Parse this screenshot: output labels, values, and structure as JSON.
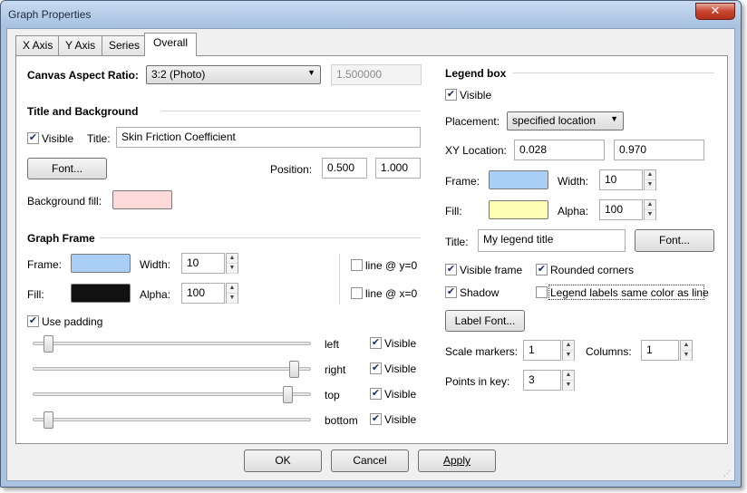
{
  "window": {
    "title": "Graph Properties",
    "close_glyph": "✕"
  },
  "tabs": [
    "X Axis",
    "Y Axis",
    "Series",
    "Overall"
  ],
  "left": {
    "canvas_aspect_label": "Canvas Aspect Ratio:",
    "canvas_aspect_value": "3:2 (Photo)",
    "canvas_aspect_number": "1.500000",
    "title_bg_header": "Title and Background",
    "visible_label": "Visible",
    "visible_checked": true,
    "title_label": "Title:",
    "title_value": "Skin Friction Coefficient",
    "font_button": "Font...",
    "position_label": "Position:",
    "position_x": "0.500",
    "position_y": "1.000",
    "bg_fill_label": "Background fill:",
    "bg_fill_color": "#fdd9d9",
    "graph_frame_header": "Graph Frame",
    "frame_label": "Frame:",
    "frame_color": "#a9cff6",
    "width_label": "Width:",
    "width_value": "10",
    "fill_label": "Fill:",
    "fill_color": "#111111",
    "alpha_label": "Alpha:",
    "alpha_value": "100",
    "line_y0": "line @ y=0",
    "line_x0": "line @ x=0",
    "use_padding": "Use padding",
    "padding_rows": [
      {
        "label": "left",
        "visible": "Visible",
        "level": 0.06
      },
      {
        "label": "right",
        "visible": "Visible",
        "level": 0.94
      },
      {
        "label": "top",
        "visible": "Visible",
        "level": 0.92
      },
      {
        "label": "bottom",
        "visible": "Visible",
        "level": 0.06
      }
    ]
  },
  "right": {
    "legend_header": "Legend box",
    "visible_label": "Visible",
    "placement_label": "Placement:",
    "placement_value": "specified location",
    "xy_label": "XY Location:",
    "xy_x": "0.028",
    "xy_y": "0.970",
    "frame_label": "Frame:",
    "frame_color": "#a9cff6",
    "width_label": "Width:",
    "width_value": "10",
    "fill_label": "Fill:",
    "fill_color": "#ffffb3",
    "alpha_label": "Alpha:",
    "alpha_value": "100",
    "title_label": "Title:",
    "title_value": "My legend title",
    "font_button": "Font...",
    "visible_frame": "Visible frame",
    "rounded_corners": "Rounded corners",
    "shadow": "Shadow",
    "legend_same_color": "Legend labels same color as line",
    "label_font_button": "Label Font...",
    "scale_markers_label": "Scale markers:",
    "scale_markers_value": "1",
    "columns_label": "Columns:",
    "columns_value": "1",
    "points_label": "Points in key:",
    "points_value": "3"
  },
  "buttons": {
    "ok": "OK",
    "cancel": "Cancel",
    "apply": "Apply"
  },
  "check_glyph": "✔",
  "spin_up": "▲",
  "spin_down": "▼",
  "combo_arrow": "▼"
}
